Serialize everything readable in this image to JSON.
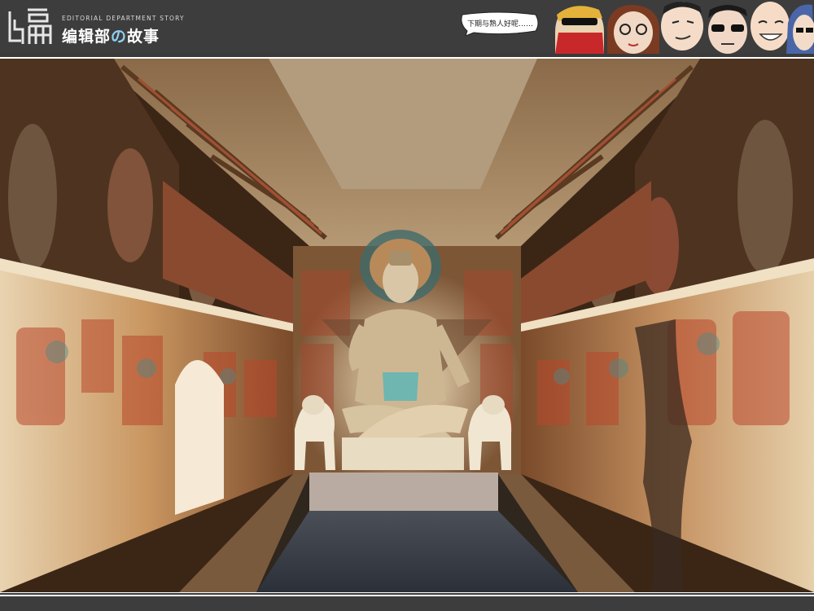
{
  "brand": {
    "logo_icon": "bian-character-logo",
    "name_en": "EDITORIAL DEPARTMENT STORY",
    "name_cn_part1": "编辑部",
    "name_cn_particle": "の",
    "name_cn_part2": "故事"
  },
  "speech_bubble": {
    "text": "下期与熟人好呢……"
  },
  "avatars": [
    {
      "icon": "masked-character-avatar-icon"
    },
    {
      "icon": "woman-glasses-avatar-icon"
    },
    {
      "icon": "man-avatar-icon"
    },
    {
      "icon": "sunglasses-man-avatar-icon"
    },
    {
      "icon": "smiling-man-avatar-icon"
    },
    {
      "icon": "blue-hair-avatar-icon"
    },
    {
      "icon": "partial-avatar-icon"
    }
  ],
  "photo": {
    "subject": "mural-cave-buddha-statue-image"
  },
  "colors": {
    "bar": "#3d3d3d",
    "accent": "#8fd0f0"
  }
}
